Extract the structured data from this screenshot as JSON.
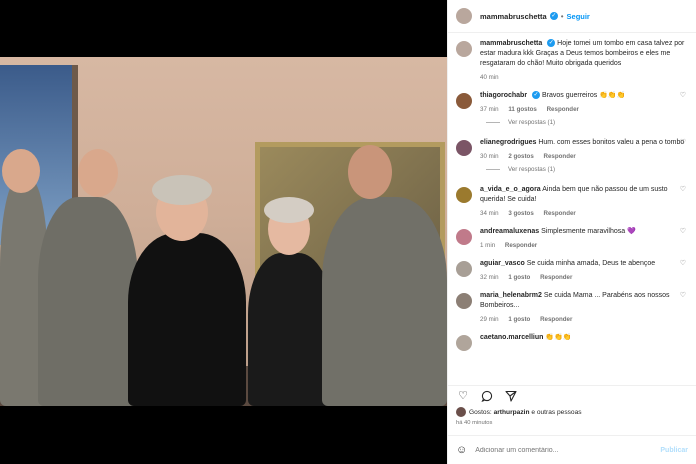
{
  "header": {
    "username": "mammabruschetta",
    "follow_label": "Seguir"
  },
  "caption": {
    "username": "mammabruschetta",
    "text": "Hoje tomei um tombo em casa talvez por estar madura kkk Graças a Deus temos bombeiros e eles me resgataram do chão! Muito obrigada queridos",
    "time": "40 min"
  },
  "comments": [
    {
      "username": "thiagorochabr",
      "verified": true,
      "text": "Bravos guerreiros 👏👏👏",
      "time": "37 min",
      "likes": "11 gostos",
      "reply": "Responder",
      "replies": "Ver respostas (1)"
    },
    {
      "username": "elianegrodrigues",
      "verified": false,
      "text": "Hum. com esses bonitos valeu a pena o tombo",
      "time": "30 min",
      "likes": "2 gostos",
      "reply": "Responder",
      "replies": "Ver respostas (1)"
    },
    {
      "username": "a_vida_e_o_agora",
      "verified": false,
      "text": "Ainda bem que não passou de um susto querida! Se cuida!",
      "time": "34 min",
      "likes": "3 gostos",
      "reply": "Responder"
    },
    {
      "username": "andreamaluxenas",
      "verified": false,
      "text": "Simplesmente maravilhosa 💜",
      "time": "1 min",
      "likes": "",
      "reply": "Responder"
    },
    {
      "username": "aguiar_vasco",
      "verified": false,
      "text": "Se cuida minha amada, Deus te abençoe",
      "time": "32 min",
      "likes": "1 gosto",
      "reply": "Responder"
    },
    {
      "username": "maria_helenabrm2",
      "verified": false,
      "text": "Se cuida Mama ... Parabéns aos nossos Bombeiros...",
      "time": "29 min",
      "likes": "1 gosto",
      "reply": "Responder"
    },
    {
      "username": "caetano.marcelliun",
      "verified": false,
      "text": "👏👏👏",
      "time": "",
      "likes": "",
      "reply": ""
    }
  ],
  "likes_line": {
    "prefix": "Gostos:",
    "user": "arthurpazin",
    "suffix": "e outras pessoas"
  },
  "post_time": "há 40 minutos",
  "comment_box": {
    "placeholder": "Adicionar um comentário...",
    "post_label": "Publicar"
  },
  "icons": [
    "heart-icon",
    "comment-icon",
    "share-icon",
    "emoji-icon",
    "verified-icon"
  ],
  "colors": {
    "accent": "#0095f6",
    "verified": "#1d9bf0",
    "muted": "#737373"
  }
}
